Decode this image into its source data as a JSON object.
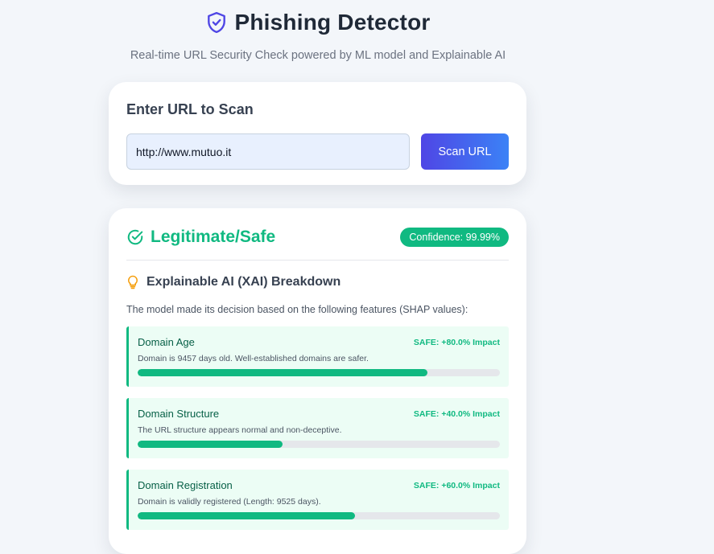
{
  "header": {
    "title": "Phishing Detector",
    "subtitle": "Real-time URL Security Check powered by ML model and Explainable AI",
    "icon": "shield-check-icon"
  },
  "scan": {
    "heading": "Enter URL to Scan",
    "url_value": "http://www.mutuo.it",
    "button_label": "Scan URL"
  },
  "result": {
    "verdict": "Legitimate/Safe",
    "verdict_icon": "check-circle-icon",
    "confidence": "Confidence: 99.99%",
    "xai_title": "Explainable AI (XAI) Breakdown",
    "xai_icon": "lightbulb-icon",
    "xai_description": "The model made its decision based on the following features (SHAP values):",
    "features": [
      {
        "name": "Domain Age",
        "impact": "SAFE: +80.0% Impact",
        "description": "Domain is 9457 days old. Well-established domains are safer.",
        "bar_fraction": 0.8
      },
      {
        "name": "Domain Structure",
        "impact": "SAFE: +40.0% Impact",
        "description": "The URL structure appears normal and non-deceptive.",
        "bar_fraction": 0.4
      },
      {
        "name": "Domain Registration",
        "impact": "SAFE: +60.0% Impact",
        "description": "Domain is validly registered (Length: 9525 days).",
        "bar_fraction": 0.6
      }
    ]
  },
  "colors": {
    "safe": "#10b981",
    "accent_start": "#4f46e5",
    "accent_end": "#3b82f6",
    "icon_purple": "#4f46e5",
    "icon_amber": "#f59e0b"
  }
}
